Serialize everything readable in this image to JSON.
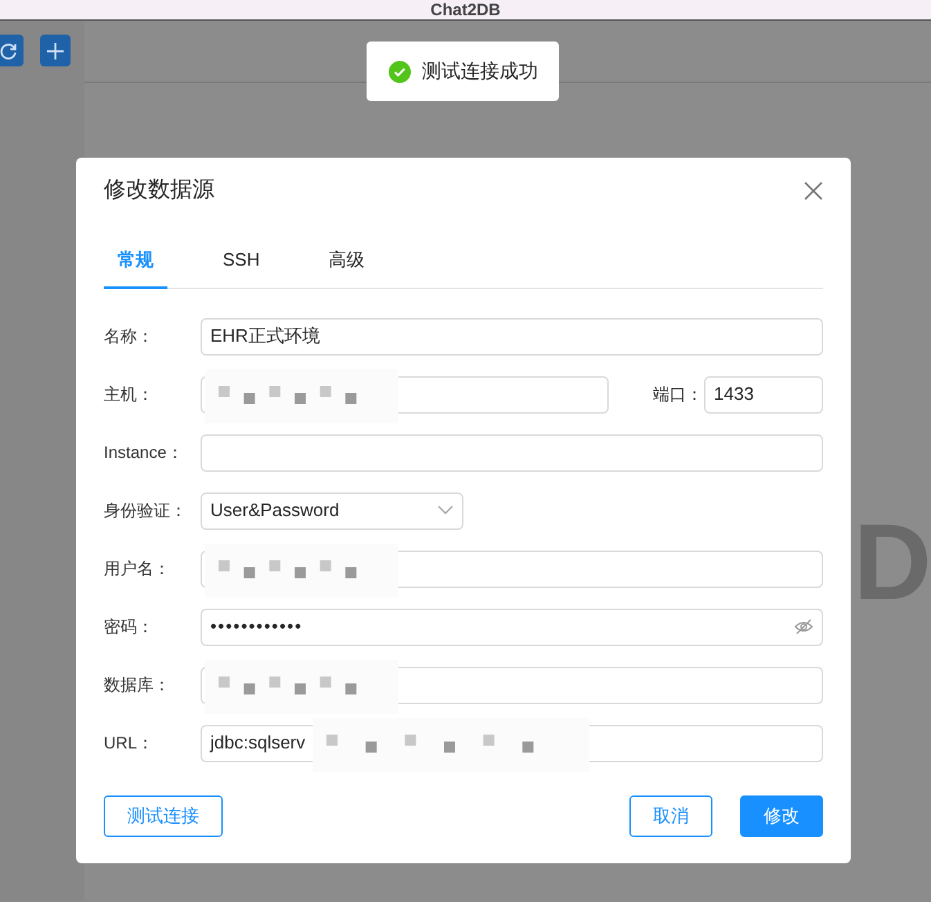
{
  "window": {
    "title": "Chat2DB"
  },
  "toolbar": {
    "buttons": [
      {
        "kind": "refresh"
      },
      {
        "kind": "add"
      }
    ]
  },
  "background_logo": {
    "text": "D"
  },
  "toast": {
    "kind": "success",
    "message": "测试连接成功"
  },
  "dialog": {
    "title": "修改数据源",
    "tabs": [
      {
        "label": "常规",
        "selected": true
      },
      {
        "label": "SSH",
        "selected": false
      },
      {
        "label": "高级",
        "selected": false
      }
    ],
    "fields": [
      {
        "kind": "text",
        "label": "名称：",
        "value": "EHR正式环境"
      },
      {
        "kind": "host",
        "label": "主机：",
        "redacted": true,
        "port_label": "端口：",
        "port_value": "1433"
      },
      {
        "kind": "text",
        "label": "Instance："
      },
      {
        "kind": "select",
        "label": "身份验证：",
        "value": "User&Password"
      },
      {
        "kind": "text",
        "label": "用户名：",
        "redacted": true
      },
      {
        "kind": "password",
        "label": "密码：",
        "value": "••••••••••••"
      },
      {
        "kind": "text",
        "label": "数据库：",
        "redacted": true
      },
      {
        "kind": "text",
        "label": "URL：",
        "value": "jdbc:sqlserv",
        "redacted": true
      }
    ],
    "buttons": [
      {
        "label": "测试连接",
        "kind": "outline"
      },
      {
        "label": "取消",
        "kind": "outline"
      },
      {
        "label": "修改",
        "kind": "primary"
      }
    ]
  }
}
